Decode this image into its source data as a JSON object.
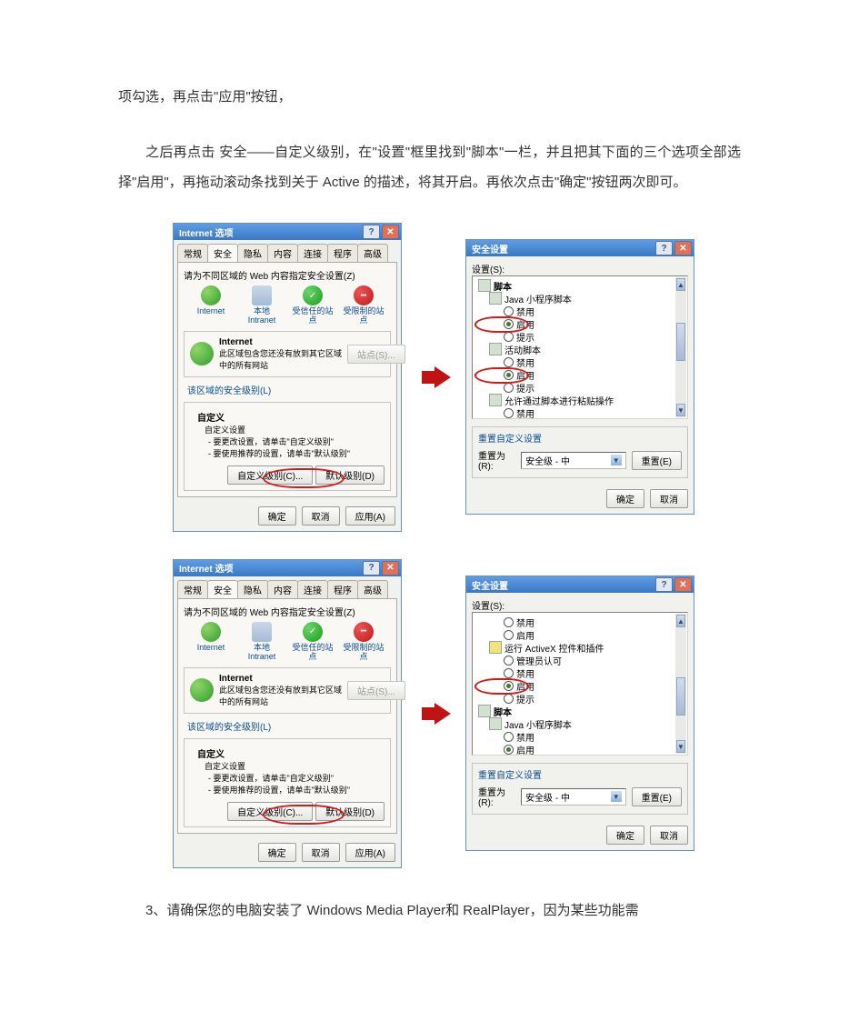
{
  "text": {
    "p1": "项勾选，再点击\"应用\"按钮，",
    "p2": "之后再点击 安全——自定义级别，在\"设置\"框里找到\"脚本\"一栏，并且把其下面的三个选项全部选择\"启用\"，再拖动滚动条找到关于 Active 的描述，将其开启。再依次点击\"确定\"按钮两次即可。",
    "p3": "3、请确保您的电脑安装了 Windows Media Player和 RealPlayer，因为某些功能需"
  },
  "dlg1_title": "Internet 选项",
  "tabs": [
    "常规",
    "安全",
    "隐私",
    "内容",
    "连接",
    "程序",
    "高级"
  ],
  "zone_hint": "请为不同区域的 Web 内容指定安全设置(Z)",
  "zones": {
    "internet": "Internet",
    "intranet": "本地\nIntranet",
    "trusted": "受信任的站\n点",
    "restricted": "受限制的站\n点"
  },
  "zonebox_title": "Internet",
  "zonebox_desc": "此区域包含您还没有放到其它区域\n中的所有网站",
  "sites_btn": "站点(S)...",
  "level_box_title": "该区域的安全级别(L)",
  "custom_label": "自定义",
  "custom_line1": "自定义设置",
  "custom_line2": "- 要更改设置，请单击\"自定义级别\"",
  "custom_line3": "- 要使用推荐的设置，请单击\"默认级别\"",
  "btn_custom_level": "自定义级别(C)...",
  "btn_default_level": "默认级别(D)",
  "btn_ok": "确定",
  "btn_cancel": "取消",
  "btn_apply": "应用(A)",
  "dlg2_title": "安全设置",
  "settings_label": "设置(S):",
  "tree1": {
    "grp_script": "脚本",
    "java_applet": "Java 小程序脚本",
    "disable": "禁用",
    "enable": "启用",
    "prompt": "提示",
    "active_script": "活动脚本",
    "paste_script": "允许通过脚本进行粘贴操作"
  },
  "reset_box_title": "重置自定义设置",
  "reset_to_label": "重置为(R):",
  "reset_combo": "安全级 - 中",
  "btn_reset": "重置(E)",
  "tree2": {
    "disable": "禁用",
    "enable": "启用",
    "run_activex": "运行 ActiveX 控件和插件",
    "admin_ok": "管理员认可",
    "prompt": "提示",
    "grp_script": "脚本",
    "java_applet": "Java 小程序脚本"
  }
}
